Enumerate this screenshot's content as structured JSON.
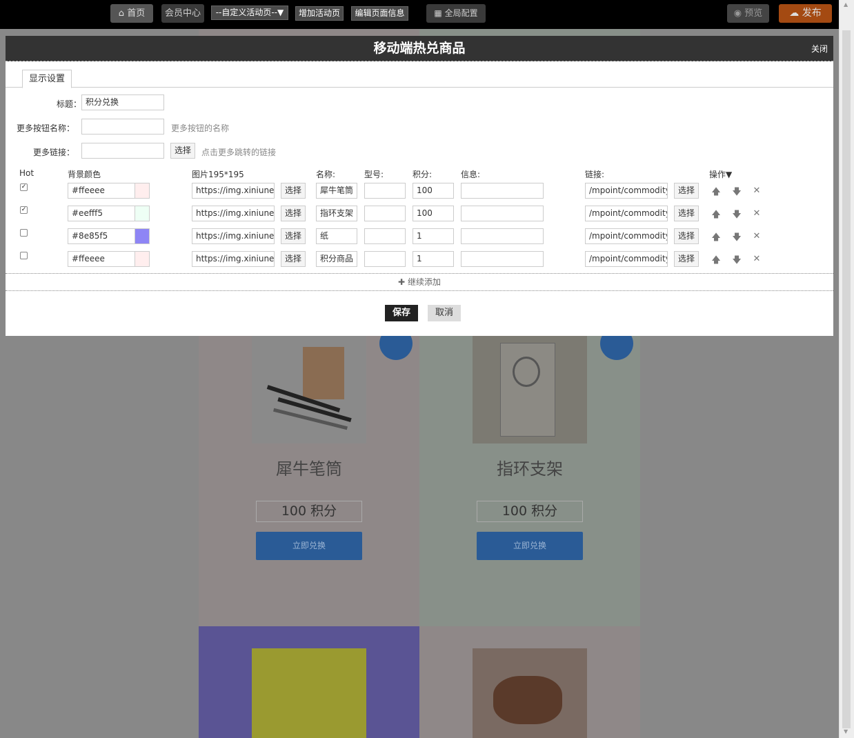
{
  "topbar": {
    "home": "首页",
    "member_center": "会员中心",
    "custom_select": "--自定义活动页--",
    "add_activity": "增加活动页",
    "edit_page_info": "编辑页面信息",
    "global_config": "全局配置",
    "preview": "预览",
    "publish": "发布"
  },
  "dialog": {
    "title": "移动端热兑商品",
    "close": "关闭",
    "tab_display": "显示设置",
    "form": {
      "title_label": "标题：",
      "title_value": "积分兑换",
      "more_btn_label": "更多按钮名称：",
      "more_btn_value": "",
      "more_btn_hint": "更多按钮的名称",
      "more_link_label": "更多链接：",
      "more_link_value": "",
      "more_link_select": "选择",
      "more_link_hint": "点击更多跳转的链接"
    },
    "table": {
      "headers": {
        "hot": "Hot",
        "bg_color": "背景颜色",
        "image": "图片195*195",
        "name": "名称:",
        "model": "型号:",
        "points": "积分:",
        "info": "信息:",
        "link": "链接:",
        "ops": "操作▼"
      },
      "select_label": "选择",
      "rows": [
        {
          "hot": true,
          "color": "#ffeeee",
          "image": "https://img.xiniunet.c",
          "name": "犀牛笔筒",
          "model": "",
          "points": "100",
          "info": "",
          "link": "/mpoint/commodity/1"
        },
        {
          "hot": true,
          "color": "#eefff5",
          "image": "https://img.xiniunet.c",
          "name": "指环支架",
          "model": "",
          "points": "100",
          "info": "",
          "link": "/mpoint/commodity/1"
        },
        {
          "hot": false,
          "color": "#8e85f5",
          "image": "https://img.xiniunet.c",
          "name": "纸",
          "model": "",
          "points": "1",
          "info": "",
          "link": "/mpoint/commodity/1"
        },
        {
          "hot": false,
          "color": "#ffeeee",
          "image": "https://img.xiniunet.c",
          "name": "积分商品",
          "model": "",
          "points": "1",
          "info": "",
          "link": "/mpoint/commodity/1"
        }
      ]
    },
    "add_more": "继续添加",
    "save": "保存",
    "cancel": "取消"
  },
  "background_products": [
    {
      "name": "犀牛笔筒",
      "points": "100 积分",
      "button": "立即兑换"
    },
    {
      "name": "指环支架",
      "points": "100 积分",
      "button": "立即兑换"
    }
  ]
}
